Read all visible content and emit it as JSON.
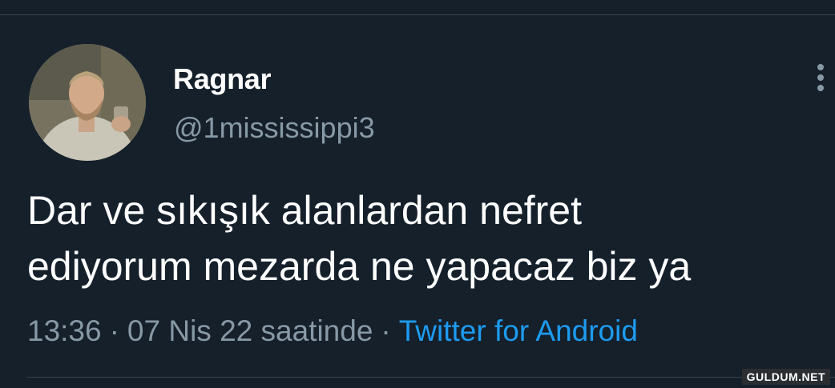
{
  "tweet": {
    "author": {
      "display_name": "Ragnar",
      "handle": "@1mississippi3"
    },
    "text_line1": "Dar ve sıkışık alanlardan nefret",
    "text_line2": "ediyorum mezarda ne yapacaz biz ya",
    "time": "13:36",
    "date": "07 Nis 22 saatinde",
    "separator": "·",
    "source": "Twitter for Android"
  },
  "icons": {
    "more": "more-vertical-icon"
  },
  "colors": {
    "background": "#15202b",
    "primary_text": "#ffffff",
    "secondary_text": "#8899a6",
    "link": "#1d9bf0",
    "divider": "#38444d"
  },
  "watermark": {
    "text": "GULDUM.NET"
  }
}
